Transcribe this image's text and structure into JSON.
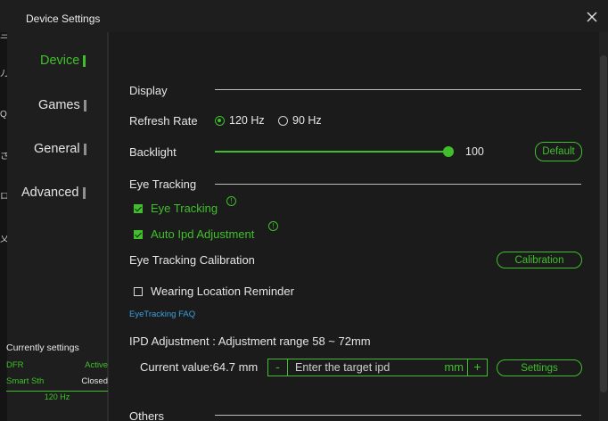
{
  "window": {
    "title": "Device Settings"
  },
  "leftstrip_glyphs": [
    "三",
    "刀",
    "Q",
    "さ",
    "ロ",
    "又"
  ],
  "sidebar": {
    "items": [
      {
        "label": "Device",
        "active": true
      },
      {
        "label": "Games",
        "active": false
      },
      {
        "label": "General",
        "active": false
      },
      {
        "label": "Advanced",
        "active": false
      }
    ]
  },
  "current_settings": {
    "title": "Currently settings",
    "rows": [
      {
        "key": "DFR",
        "value": "Active"
      },
      {
        "key": "Smart Sth",
        "value": "Closed"
      }
    ],
    "refresh": "120 Hz"
  },
  "display": {
    "section_title": "Display",
    "refresh_rate": {
      "label": "Refresh Rate",
      "options": [
        "120 Hz",
        "90 Hz"
      ],
      "selected": "120 Hz"
    },
    "backlight": {
      "label": "Backlight",
      "value": "100",
      "level": 1.0,
      "default_button": "Default"
    }
  },
  "eye_tracking": {
    "section_title": "Eye Tracking",
    "eye_tracking_check": {
      "label": "Eye Tracking",
      "checked": true,
      "info": "!"
    },
    "auto_ipd_check": {
      "label": "Auto Ipd Adjustment",
      "checked": true,
      "info": "!"
    },
    "calibration": {
      "label": "Eye Tracking Calibration",
      "button": "Calibration"
    },
    "wearing_reminder": {
      "label": "Wearing Location Reminder",
      "checked": false
    },
    "faq_link": "EyeTracking FAQ"
  },
  "ipd": {
    "title": "IPD Adjustment : Adjustment range 58 ~ 72mm",
    "current_label": "Current value:64.7 mm",
    "minus": "-",
    "plus": "+",
    "placeholder": "Enter the target ipd",
    "unit": "mm",
    "settings_button": "Settings"
  },
  "others": {
    "section_title": "Others"
  },
  "colors": {
    "accent": "#3fc02a",
    "link": "#3aa0e0",
    "background": "#1b1b1b"
  },
  "icons": {
    "close": "close-icon",
    "info": "info-icon"
  }
}
